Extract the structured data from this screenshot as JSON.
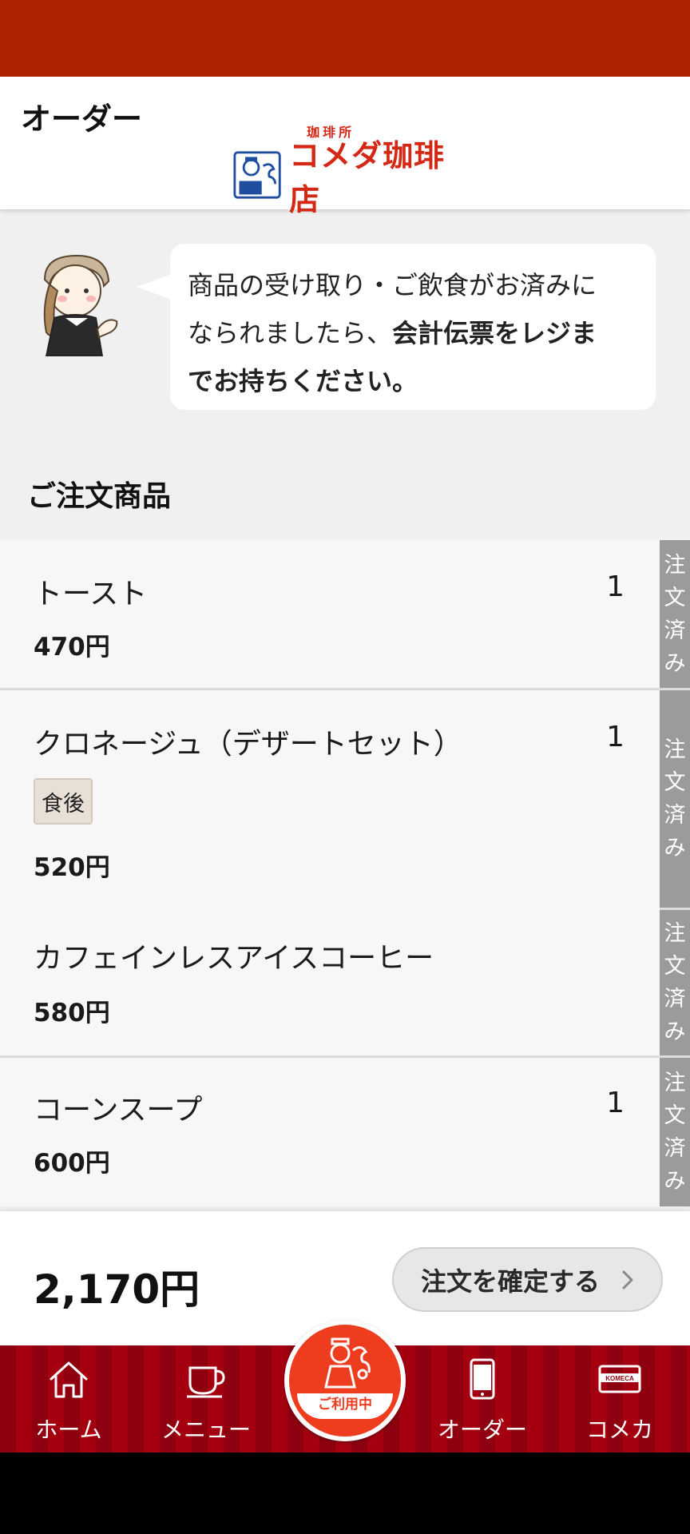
{
  "header": {
    "title": "オーダー",
    "logo_text": "コメダ珈琲店",
    "logo_sub": "珈琲所"
  },
  "message": {
    "line1": "商品の受け取り・ご飲食がお済みに",
    "line2_a": "なられましたら、",
    "line2_b": "会計伝票をレジま",
    "line3": "でお持ちください。"
  },
  "section_title": "ご注文商品",
  "status_label": [
    "注",
    "文",
    "済",
    "み"
  ],
  "items": [
    {
      "name": "トースト",
      "qty": "1",
      "price": "470円"
    },
    {
      "name": "クロネージュ（デザートセット）",
      "qty": "1",
      "tag": "食後",
      "price": "520円"
    },
    {
      "name": "カフェインレスアイスコーヒー",
      "price": "580円"
    },
    {
      "name": "コーンスープ",
      "qty": "1",
      "price": "600円"
    }
  ],
  "total": "2,170円",
  "confirm_label": "注文を確定する",
  "tabs": {
    "home": "ホーム",
    "menu": "メニュー",
    "center": "ご利用中",
    "order": "オーダー",
    "card": "コメカ",
    "card_badge": "KOMECA"
  },
  "colors": {
    "status_bar": "#ad2200",
    "tabbar": "#8e0010",
    "accent": "#ee3c1f",
    "logo_red": "#d42815"
  }
}
